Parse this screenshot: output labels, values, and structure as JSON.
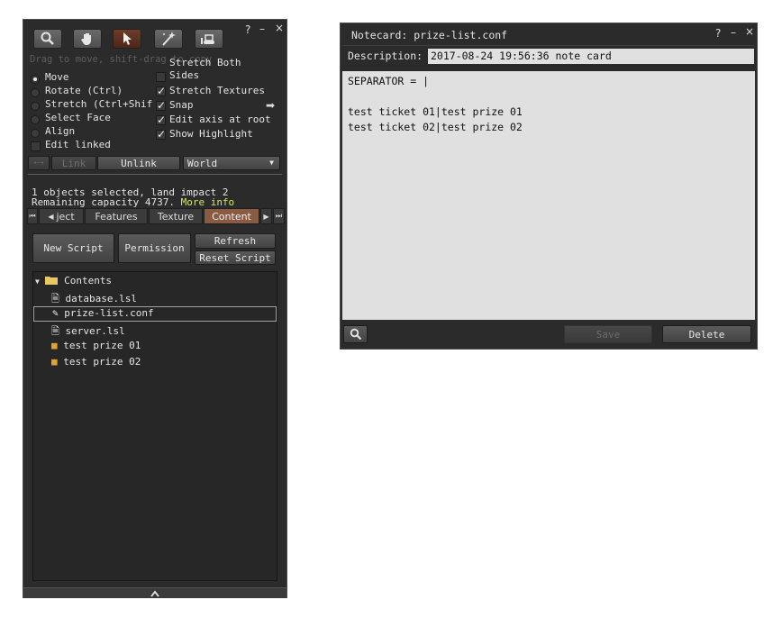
{
  "build_panel": {
    "window_controls": [
      "?",
      "–",
      "×"
    ],
    "toolbar": [
      {
        "icon": "focus-magnify-icon",
        "active": false
      },
      {
        "icon": "grab-hand-icon",
        "active": false
      },
      {
        "icon": "edit-arrow-icon",
        "active": true
      },
      {
        "icon": "create-wand-icon",
        "active": false
      },
      {
        "icon": "land-bulldozer-icon",
        "active": false
      }
    ],
    "hint": "Drag to move, shift-drag to copy",
    "modes": {
      "move": "Move",
      "rotate": "Rotate (Ctrl)",
      "stretch": "Stretch (Ctrl+Shift)",
      "select_face": "Select Face",
      "align": "Align"
    },
    "edit_linked": "Edit linked",
    "options": {
      "stretch_both": "Stretch Both",
      "sides": "Sides",
      "stretch_textures": "Stretch Textures",
      "snap": "Snap",
      "edit_axis": "Edit axis at root",
      "show_highlight": "Show Highlight"
    },
    "link_label": "Link",
    "unlink_label": "Unlink",
    "ruler_value": "World",
    "selection_info": "1 objects selected, land impact 2",
    "remaining": "Remaining capacity 4737.",
    "more_info": "More info",
    "tabs": [
      "ject",
      "Features",
      "Texture",
      "Content"
    ],
    "active_tab": "Content",
    "buttons": {
      "new_script": "New Script",
      "permission": "Permission",
      "refresh": "Refresh",
      "reset_script": "Reset Script"
    },
    "inventory": {
      "root": "Contents",
      "items": [
        {
          "name": "database.lsl",
          "icon": "script-icon"
        },
        {
          "name": "prize-list.conf",
          "icon": "notecard-icon"
        },
        {
          "name": "server.lsl",
          "icon": "script-icon"
        },
        {
          "name": "test prize 01",
          "icon": "object-box-icon"
        },
        {
          "name": "test prize 02",
          "icon": "object-box-icon"
        }
      ]
    }
  },
  "notecard": {
    "title": "Notecard: prize-list.conf",
    "window_controls": [
      "?",
      "–",
      "×"
    ],
    "description_label": "Description:",
    "description_value": "2017-08-24 19:56:36 note card",
    "body": "SEPARATOR = |\n\ntest ticket 01|test prize 01\ntest ticket 02|test prize 02",
    "save_label": "Save",
    "delete_label": "Delete"
  },
  "colors": {
    "panel_bg": "#2b2b2b",
    "active_accent": "#8a5a42",
    "link_yellow": "#d7e36a",
    "text_area_bg": "#e0e0e0"
  }
}
